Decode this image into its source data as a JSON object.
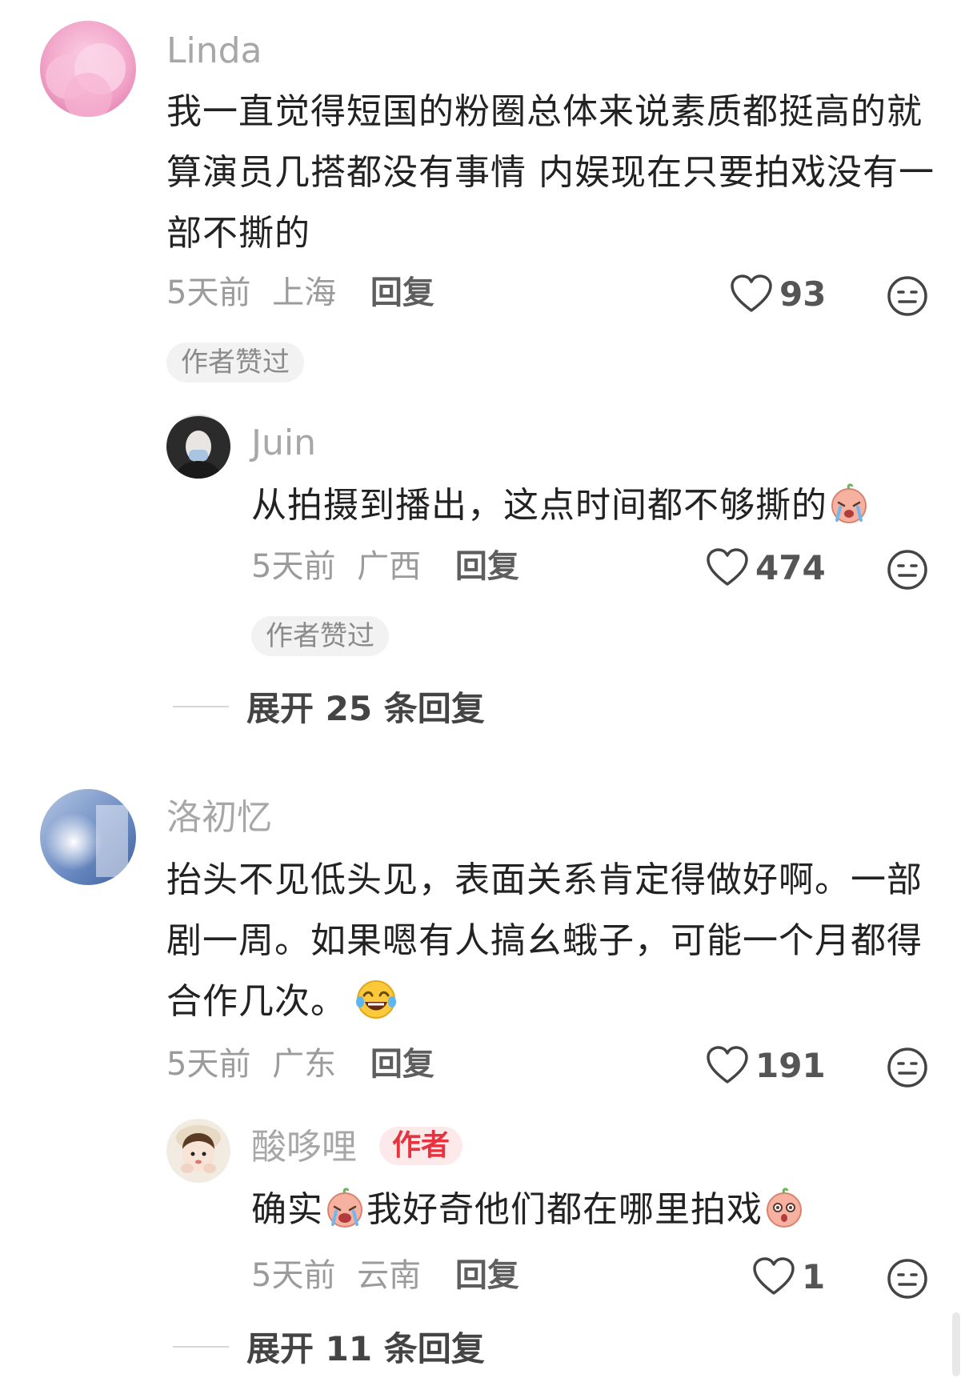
{
  "comments": [
    {
      "username": "Linda",
      "text": "我一直觉得短国的粉圈总体来说素质都挺高的就算演员几搭都没有事情 内娱现在只要拍戏没有一部不撕的",
      "time": "5天前",
      "location": "上海",
      "reply_label": "回复",
      "likes": "93",
      "badge": "作者赞过",
      "reply": {
        "username": "Juin",
        "text": "从拍摄到播出，这点时间都不够撕的",
        "time": "5天前",
        "location": "广西",
        "reply_label": "回复",
        "likes": "474",
        "badge": "作者赞过"
      },
      "expand_label": "展开 25 条回复"
    },
    {
      "username": "洛初忆",
      "text": "抬头不见低头见，表面关系肯定得做好啊。一部剧一周。如果嗯有人搞幺蛾子，可能一个月都得合作几次。",
      "time": "5天前",
      "location": "广东",
      "reply_label": "回复",
      "likes": "191",
      "reply": {
        "username": "酸哆哩",
        "author_tag": "作者",
        "text_a": "确实",
        "text_b": "我好奇他们都在哪里拍戏",
        "time": "5天前",
        "location": "云南",
        "reply_label": "回复",
        "likes": "1"
      },
      "expand_label": "展开 11 条回复"
    }
  ],
  "colors": {
    "muted": "#a7a7a7",
    "author_tag_bg": "#fde8ea",
    "author_tag_text": "#e6333f"
  }
}
